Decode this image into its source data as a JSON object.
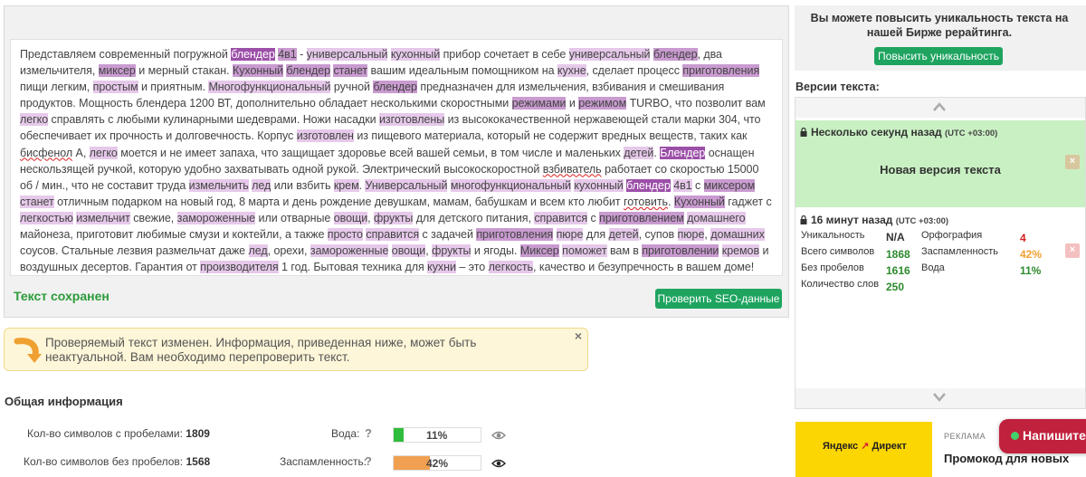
{
  "editor": {
    "segments": [
      [
        "Представляем современный погружной ",
        0
      ],
      [
        "блендер",
        3
      ],
      [
        " ",
        0
      ],
      [
        "4в1",
        2
      ],
      [
        " - ",
        0
      ],
      [
        "универсальный",
        1
      ],
      [
        " ",
        0
      ],
      [
        "кухонный",
        1
      ],
      [
        " прибор сочетает в себе ",
        0
      ],
      [
        "универсальный",
        1
      ],
      [
        " ",
        0
      ],
      [
        "блендер",
        2
      ],
      [
        ", два измельчителя, ",
        0
      ],
      [
        "миксер",
        2
      ],
      [
        " и мерный стакан. ",
        0
      ],
      [
        "Кухонный",
        2
      ],
      [
        " ",
        0
      ],
      [
        "блендер",
        2
      ],
      [
        " ",
        0
      ],
      [
        "станет",
        2
      ],
      [
        " вашим идеальным помощником на ",
        0
      ],
      [
        "кухне",
        1
      ],
      [
        ", сделает процесс ",
        0
      ],
      [
        "приготовления",
        2
      ],
      [
        " пищи легким, ",
        0
      ],
      [
        "простым",
        1
      ],
      [
        " и приятным. ",
        0
      ],
      [
        "Многофункциональный",
        1
      ],
      [
        " ручной ",
        0
      ],
      [
        "блендер",
        2
      ],
      [
        " предназначен для измельчения, взбивания и смешивания продуктов. Мощность блендера 1200 ВТ, дополнительно обладает несколькими скоростными ",
        0
      ],
      [
        "режимами",
        2
      ],
      [
        " и ",
        0
      ],
      [
        "режимом",
        2
      ],
      [
        " TURBO, что позволит вам ",
        0
      ],
      [
        "легко",
        1
      ],
      [
        " справлять с любыми кулинарными шедеврами. Ножи насадки ",
        0
      ],
      [
        "изготовлены",
        1
      ],
      [
        " из высококачественной нержавеющей стали марки 304, что обеспечивает их прочность и долговечность. Корпус ",
        0
      ],
      [
        "изготовлен",
        1
      ],
      [
        " из пищевого материала, который не содержит вредных веществ, таких как ",
        0
      ],
      [
        "бисфенол",
        4
      ],
      [
        " А, ",
        0
      ],
      [
        "легко",
        1
      ],
      [
        " моется и не имеет запаха, что защищает здоровье всей вашей семьи, в том числе и маленьких ",
        0
      ],
      [
        "детей",
        1
      ],
      [
        ". ",
        0
      ],
      [
        "Блендер",
        3
      ],
      [
        " оснащен нескользящей ручкой, которую удобно захватывать одной рукой. Электрический высокоскоростной ",
        0
      ],
      [
        "взбиватель",
        4
      ],
      [
        " работает со скоростью 15000 об / мин., что не составит труда ",
        0
      ],
      [
        "измельчить",
        1
      ],
      [
        " ",
        0
      ],
      [
        "лед",
        1
      ],
      [
        " или взбить ",
        0
      ],
      [
        "крем",
        1
      ],
      [
        ". ",
        0
      ],
      [
        "Универсальный",
        1
      ],
      [
        " ",
        0
      ],
      [
        "многофункциональный",
        1
      ],
      [
        " ",
        0
      ],
      [
        "кухонный",
        1
      ],
      [
        " ",
        0
      ],
      [
        "блендер",
        3
      ],
      [
        " ",
        0
      ],
      [
        "4в1",
        1
      ],
      [
        " с ",
        0
      ],
      [
        "миксером",
        2
      ],
      [
        " ",
        0
      ],
      [
        "станет",
        1
      ],
      [
        " отличным подарком на новый год, 8 марта и день рождение девушкам, мамам, бабушкам и всем кто любит ",
        0
      ],
      [
        "готовить",
        4
      ],
      [
        ". ",
        0
      ],
      [
        "Кухонный",
        2
      ],
      [
        " гаджет с ",
        0
      ],
      [
        "легкостью",
        1
      ],
      [
        " ",
        0
      ],
      [
        "измельчит",
        1
      ],
      [
        " свежие, ",
        0
      ],
      [
        "замороженные",
        1
      ],
      [
        " или отварные ",
        0
      ],
      [
        "овощи",
        1
      ],
      [
        ", ",
        0
      ],
      [
        "фрукты",
        1
      ],
      [
        " для детского питания, ",
        0
      ],
      [
        "справится",
        1
      ],
      [
        " с ",
        0
      ],
      [
        "приготовлением",
        2
      ],
      [
        " ",
        0
      ],
      [
        "домашнего",
        1
      ],
      [
        " майонеза, приготовит любимые смузи и коктейли, а также ",
        0
      ],
      [
        "просто",
        1
      ],
      [
        " ",
        0
      ],
      [
        "справится",
        1
      ],
      [
        " с задачей ",
        0
      ],
      [
        "приготовления",
        2
      ],
      [
        " ",
        0
      ],
      [
        "пюре",
        1
      ],
      [
        " для ",
        0
      ],
      [
        "детей",
        1
      ],
      [
        ", супов ",
        0
      ],
      [
        "пюре",
        1
      ],
      [
        ", ",
        0
      ],
      [
        "домашних",
        1
      ],
      [
        " соусов. Стальные лезвия размельчат даже ",
        0
      ],
      [
        "лед",
        1
      ],
      [
        ", орехи, ",
        0
      ],
      [
        "замороженные",
        1
      ],
      [
        " ",
        0
      ],
      [
        "овощи",
        1
      ],
      [
        ", ",
        0
      ],
      [
        "фрукты",
        1
      ],
      [
        " и ягоды. ",
        0
      ],
      [
        "Миксер",
        2
      ],
      [
        " ",
        0
      ],
      [
        "поможет",
        1
      ],
      [
        " вам в ",
        0
      ],
      [
        "приготовлении",
        2
      ],
      [
        " ",
        0
      ],
      [
        "кремов",
        1
      ],
      [
        " и воздушных десертов. Гарантия от ",
        0
      ],
      [
        "производителя",
        1
      ],
      [
        " 1 год. Бытовая техника для ",
        0
      ],
      [
        "кухни",
        1
      ],
      [
        " – это ",
        0
      ],
      [
        "легкость",
        1
      ],
      [
        ", качество и безупречность в вашем доме!",
        0
      ]
    ],
    "saved_label": "Текст сохранен",
    "seo_button": "Проверить SEO-данные"
  },
  "warning": {
    "text": "Проверяемый текст изменен. Информация, приведенная ниже, может быть неактуальной. Вам необходимо перепроверить текст.",
    "close": "×"
  },
  "general": {
    "title": "Общая информация",
    "chars_with_spaces_label": "Кол-во символов с пробелами:",
    "chars_with_spaces": "1809",
    "chars_without_spaces_label": "Кол-во символов без пробелов:",
    "chars_without_spaces": "1568",
    "water_label": "Вода:",
    "water_value": "11%",
    "water_fraction": 0.11,
    "spam_label": "Заспамленность:",
    "spam_value": "42%",
    "spam_fraction": 0.42,
    "help": "?"
  },
  "promo": {
    "text": "Вы можете повысить уникальность текста на нашей Бирже рерайтинга.",
    "button": "Повысить уникальность"
  },
  "versions": {
    "title": "Версии текста:",
    "v1": {
      "time": "Несколько секунд назад",
      "utc": "(UTC +03:00)",
      "label": "Новая версия текста"
    },
    "v2": {
      "time": "16 минут назад",
      "utc": "(UTC +03:00)",
      "uniq_label": "Уникальность",
      "uniq": "N/A",
      "total_label": "Всего символов",
      "total": "1868",
      "nospace_label": "Без пробелов",
      "nospace": "1616",
      "words_label": "Количество слов",
      "words": "250",
      "spell_label": "Орфография",
      "spell": "4",
      "spam_label": "Заспамленность",
      "spam": "42%",
      "water_label": "Вода",
      "water": "11%"
    },
    "delete": "×"
  },
  "ad": {
    "brand_a": "Яндекс",
    "brand_b": "Директ",
    "label": "РЕКЛАМА",
    "headline": "Промокод для новых"
  },
  "chat": {
    "label": "Напишите"
  },
  "colors": {
    "accent_green": "#1fa460",
    "highlight_light": "#e6c9ea",
    "highlight_mid": "#c99bd0",
    "highlight_dark": "#9c4fa8",
    "version_bg": "#c9f0c3",
    "chat_red": "#c0213c"
  }
}
